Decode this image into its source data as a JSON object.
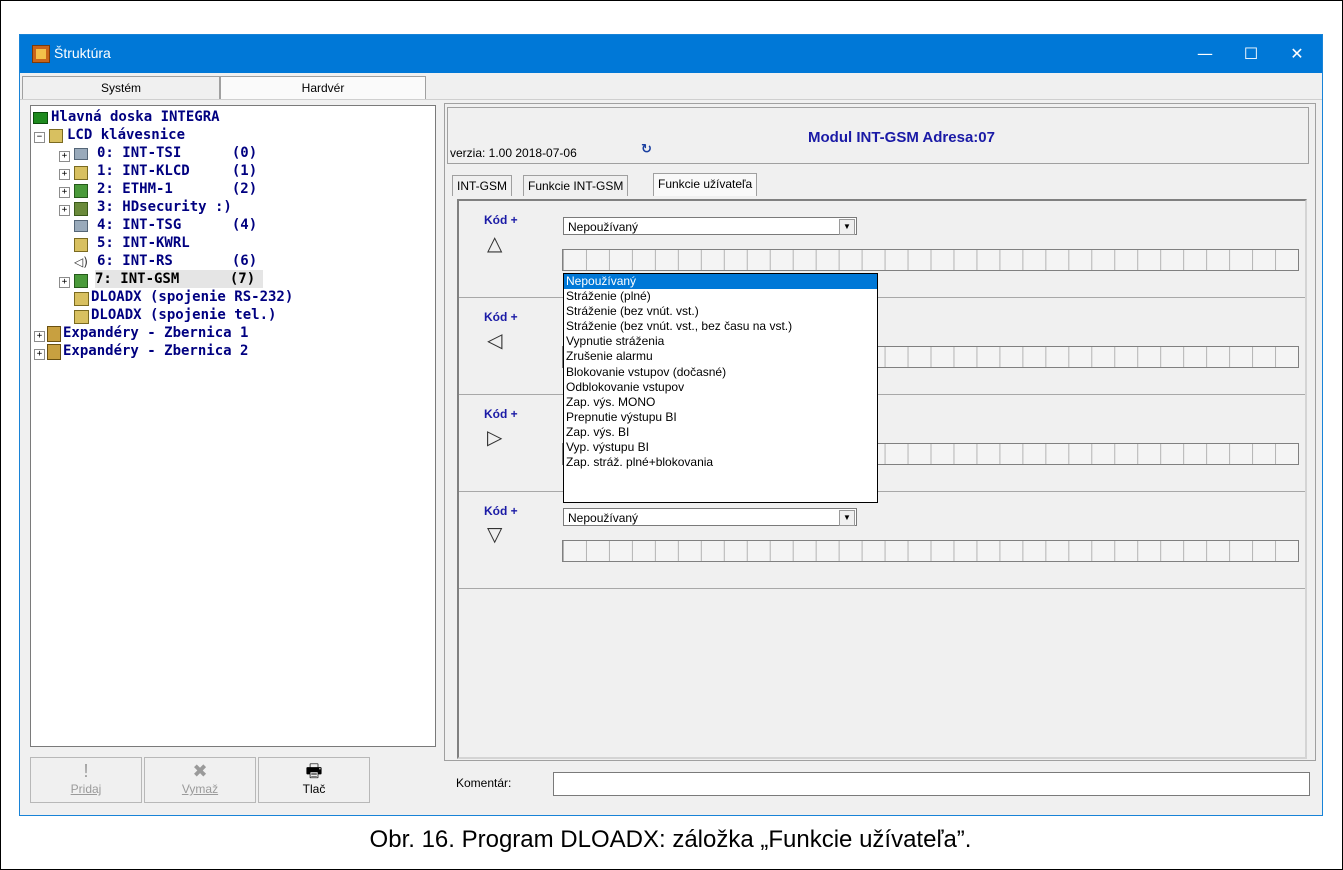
{
  "window": {
    "title": "Štruktúra",
    "minimize": "—",
    "maximize": "☐",
    "close": "✕"
  },
  "left_tabs": [
    "Systém",
    "Hardvér"
  ],
  "tree": {
    "root": "Hlavná doska INTEGRA",
    "lcd_group": "LCD klávesnice",
    "devices": [
      "0: INT-TSI      (0)",
      "1: INT-KLCD     (1)",
      "2: ETHM-1       (2)",
      "3: HDsecurity :)",
      "4: INT-TSG      (4)",
      "5: INT-KWRL",
      "6: INT-RS       (6)",
      "7: INT-GSM      (7)"
    ],
    "dloadx_rs": "DLOADX (spojenie RS-232)",
    "dloadx_tel": "DLOADX (spojenie tel.)",
    "bus1": "Expandéry - Zbernica 1",
    "bus2": "Expandéry - Zbernica 2"
  },
  "bottom_buttons": {
    "add": "Pridaj",
    "delete": "Vymaž",
    "print": "Tlač"
  },
  "header": {
    "version": "verzia: 1.00 2018-07-06",
    "module_title": "Modul INT-GSM Adresa:07"
  },
  "inner_tabs": [
    "INT-GSM",
    "Funkcie INT-GSM",
    "Funkcie užívateľa"
  ],
  "sections": [
    {
      "label": "Kód +",
      "arrow": "up-arrow-icon",
      "glyph": "△",
      "value": "Nepoužívaný"
    },
    {
      "label": "Kód +",
      "arrow": "left-arrow-icon",
      "glyph": "◁",
      "value": ""
    },
    {
      "label": "Kód +",
      "arrow": "right-arrow-icon",
      "glyph": "▷",
      "value": ""
    },
    {
      "label": "Kód +",
      "arrow": "down-arrow-icon",
      "glyph": "▽",
      "value": "Nepoužívaný"
    }
  ],
  "dropdown_options": [
    "Nepoužívaný",
    "Stráženie (plné)",
    "Stráženie (bez vnút. vst.)",
    "Stráženie (bez vnút. vst., bez času na vst.)",
    "Vypnutie stráženia",
    "Zrušenie alarmu",
    "Blokovanie vstupov (dočasné)",
    "Odblokovanie vstupov",
    "Zap. výs. MONO",
    "Prepnutie výstupu BI",
    "Zap. výs. BI",
    "Vyp. výstupu BI",
    "Zap. stráž. plné+blokovania"
  ],
  "comment": {
    "label": "Komentár:",
    "value": ""
  },
  "caption": "Obr. 16. Program DLOADX: záložka „Funkcie užívateľa”.",
  "colors": {
    "titlebar": "#0078d7",
    "navy_text": "#000080",
    "accent_blue": "#1a1aa6",
    "selection": "#0078d7"
  }
}
